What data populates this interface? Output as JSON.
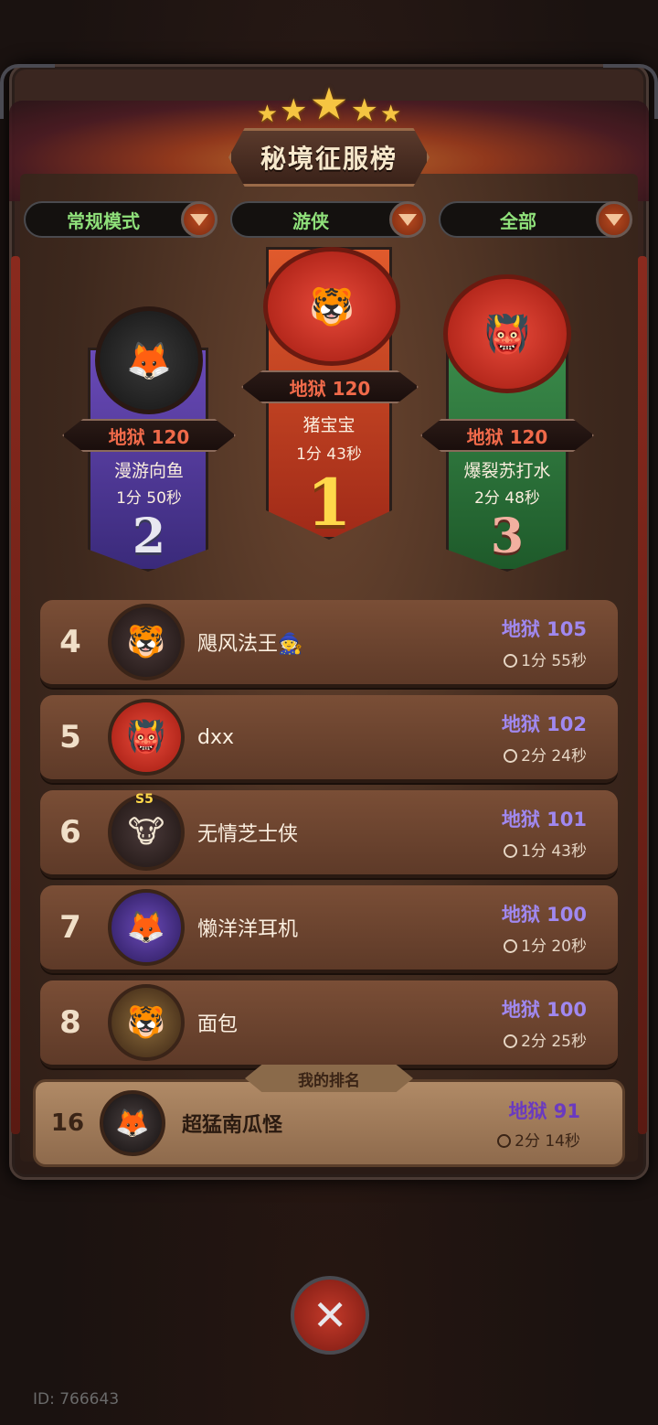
{
  "header": {
    "title": "秘境征服榜",
    "stars": 5
  },
  "filters": {
    "mode": "常规模式",
    "class": "游侠",
    "range": "全部"
  },
  "podium": [
    {
      "rank": "1",
      "difficulty": "地狱 120",
      "name": "猪宝宝",
      "time": "1分 43秒"
    },
    {
      "rank": "2",
      "difficulty": "地狱 120",
      "name": "漫游向鱼",
      "time": "1分 50秒"
    },
    {
      "rank": "3",
      "difficulty": "地狱 120",
      "name": "爆裂苏打水",
      "time": "2分 48秒"
    }
  ],
  "rows": [
    {
      "rank": "4",
      "name": "飓风法王🧙",
      "difficulty": "地狱 105",
      "time": "1分 55秒"
    },
    {
      "rank": "5",
      "name": "dxx",
      "difficulty": "地狱 102",
      "time": "2分 24秒"
    },
    {
      "rank": "6",
      "name": "无情芝士侠",
      "difficulty": "地狱 101",
      "time": "1分 43秒",
      "badge": "S5"
    },
    {
      "rank": "7",
      "name": "懒洋洋耳机",
      "difficulty": "地狱 100",
      "time": "1分 20秒"
    },
    {
      "rank": "8",
      "name": "面包",
      "difficulty": "地狱 100",
      "time": "2分 25秒"
    }
  ],
  "my_rank": {
    "label": "我的排名",
    "rank": "16",
    "name": "超猛南瓜怪",
    "difficulty": "地狱 91",
    "time": "2分 14秒"
  },
  "footer": {
    "user_id": "ID: 766643",
    "close_icon": "close-x-icon"
  },
  "colors": {
    "filter_text": "#8fe07a",
    "difficulty_purple": "#a088f0",
    "difficulty_red": "#f06a4a",
    "gold": "#ffd84a"
  }
}
